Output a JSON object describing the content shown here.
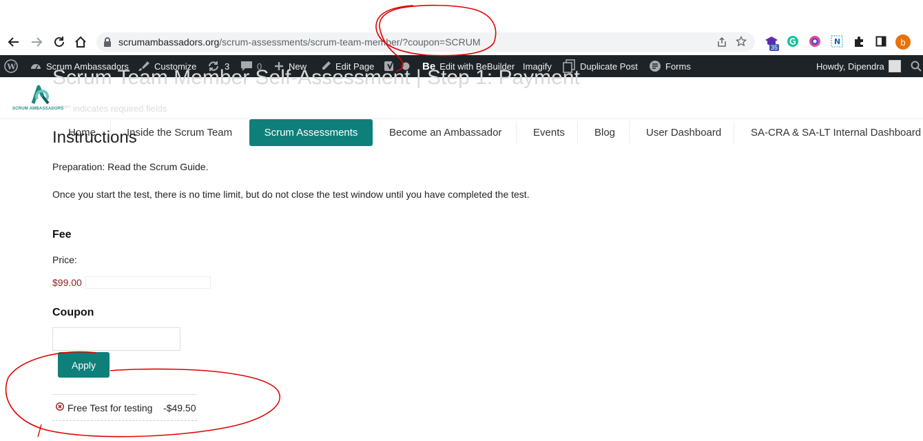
{
  "browser": {
    "url_host": "scrumambassadors.org",
    "url_path": "/scrum-assessments/scrum-team-member/?coupon=SCRUM",
    "extension_badge": "35",
    "profile_initial": "b",
    "icons": [
      "back-arrow-icon",
      "forward-arrow-icon",
      "reload-icon",
      "home-icon",
      "lock-icon",
      "share-icon",
      "star-icon",
      "extensions-puzzle-icon",
      "side-panel-icon"
    ]
  },
  "adminbar": {
    "site_name": "Scrum Ambassadors",
    "customize": "Customize",
    "updates_count": "3",
    "comments_count": "0",
    "new": "New",
    "edit_page": "Edit Page",
    "bebuilder_logo": "Be",
    "bebuilder": "Edit with BeBuilder",
    "imagify": "Imagify",
    "duplicate_post": "Duplicate Post",
    "forms": "Forms",
    "howdy": "Howdy, Dipendra"
  },
  "page": {
    "title": "Scrum Team Member Self-Assessment | Step 1: Payment",
    "required_note": "\"*\" indicates required fields"
  },
  "site": {
    "logo_text": "SCRUM AMBASSADORS",
    "menu": [
      {
        "label": "Home",
        "active": false
      },
      {
        "label": "Inside the Scrum Team",
        "active": false
      },
      {
        "label": "Scrum Assessments",
        "active": true
      },
      {
        "label": "Become an Ambassador",
        "active": false
      },
      {
        "label": "Events",
        "active": false
      },
      {
        "label": "Blog",
        "active": false
      },
      {
        "label": "User Dashboard",
        "active": false
      },
      {
        "label": "SA-CRA & SA-LT Internal Dashboard",
        "active": false
      }
    ]
  },
  "content": {
    "instructions_heading": "Instructions",
    "preparation": "Preparation: Read the Scrum Guide.",
    "time_note": "Once you start the test, there is no time limit, but do not close the test window until you have completed the test.",
    "fee_heading": "Fee",
    "price_label": "Price:",
    "price_value": "$99.00",
    "coupon_heading": "Coupon",
    "coupon_input_value": "",
    "apply_label": "Apply",
    "applied_coupon": {
      "name": "Free Test for testing",
      "amount": "-$49.50"
    }
  },
  "colors": {
    "accent": "#0f7f7a",
    "adminbar_bg": "#1d2327",
    "price": "#8b2020",
    "annotation": "#e00000"
  }
}
